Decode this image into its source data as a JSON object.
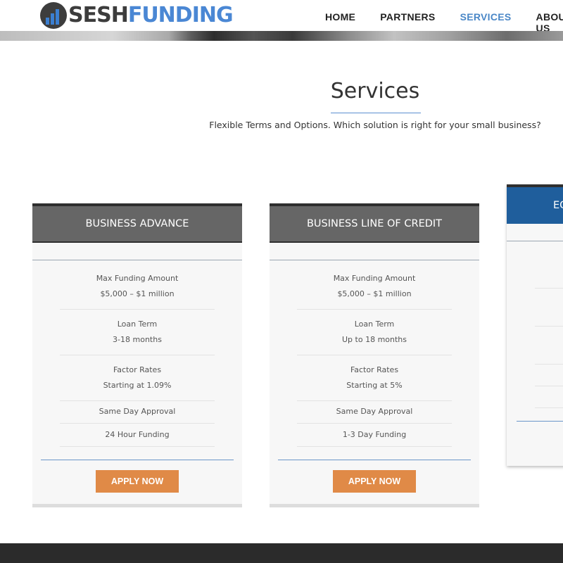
{
  "brand": {
    "logo_part1": "SESH",
    "logo_part2": "FUNDING",
    "accent_color": "#4a87d4"
  },
  "nav": {
    "items": [
      {
        "label": "HOME",
        "active": false
      },
      {
        "label": "PARTNERS",
        "active": false
      },
      {
        "label": "SERVICES",
        "active": true
      },
      {
        "label": "ABOUT US",
        "active": false
      }
    ]
  },
  "page": {
    "title": "Services",
    "subtitle": "Flexible Terms and Options. Which solution is right for your small business?"
  },
  "cards": [
    {
      "title": "BUSINESS ADVANCE",
      "features": [
        {
          "label": "Max Funding Amount",
          "value": "$5,000 – $1 million"
        },
        {
          "label": "Loan Term",
          "value": "3-18 months"
        },
        {
          "label": "Factor Rates",
          "value": "Starting at 1.09%"
        },
        {
          "label": "Same Day Approval"
        },
        {
          "label": "24 Hour Funding"
        }
      ],
      "button": "APPLY NOW"
    },
    {
      "title": "BUSINESS LINE OF CREDIT",
      "features": [
        {
          "label": "Max Funding Amount",
          "value": "$5,000 – $1 million"
        },
        {
          "label": "Loan Term",
          "value": "Up to 18 months"
        },
        {
          "label": "Factor Rates",
          "value": "Starting at 5%"
        },
        {
          "label": "Same Day Approval"
        },
        {
          "label": "1-3 Day Funding"
        }
      ],
      "button": "APPLY NOW"
    },
    {
      "title": "EQ"
    }
  ],
  "colors": {
    "card_header": "#666666",
    "featured_header": "#1f5e9c",
    "button": "#e08a47",
    "footer": "#2b2b2b"
  }
}
